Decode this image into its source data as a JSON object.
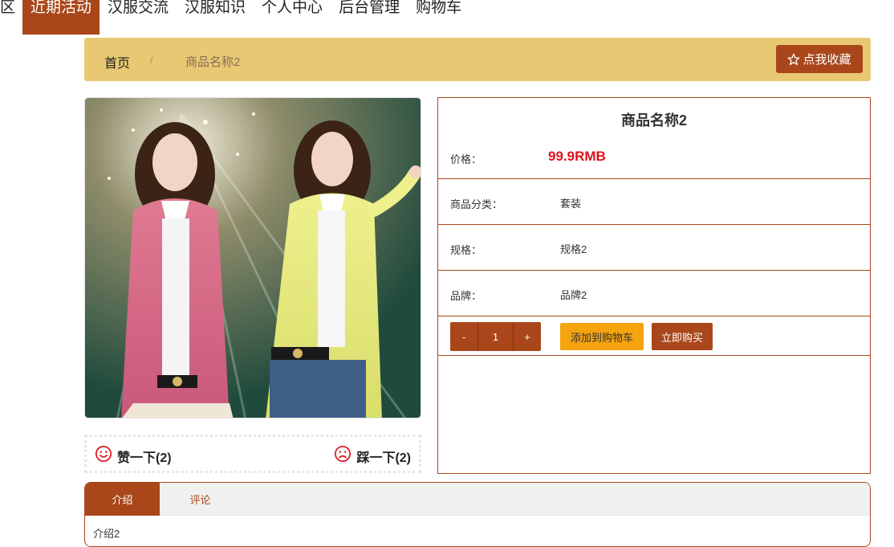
{
  "nav": {
    "items": [
      {
        "label": "区",
        "active": false
      },
      {
        "label": "近期活动",
        "active": true
      },
      {
        "label": "汉服交流",
        "active": false
      },
      {
        "label": "汉服知识",
        "active": false
      },
      {
        "label": "个人中心",
        "active": false
      },
      {
        "label": "后台管理",
        "active": false
      },
      {
        "label": "购物车",
        "active": false
      }
    ]
  },
  "breadcrumb": {
    "home": "首页",
    "separator": "/",
    "current": "商品名称2"
  },
  "favorite_button": {
    "label": "点我收藏",
    "icon": "star-outline-icon"
  },
  "product": {
    "image_alt": "商品图片",
    "title": "商品名称2",
    "price_label": "价格：",
    "price": "99.9RMB",
    "category_label": "商品分类：",
    "category": "套装",
    "spec_label": "规格：",
    "spec": "规格2",
    "brand_label": "品牌：",
    "brand": "品牌2"
  },
  "quantity": {
    "minus": "-",
    "value": "1",
    "plus": "+"
  },
  "actions": {
    "add_to_cart": "添加到购物车",
    "buy_now": "立即购买"
  },
  "votes": {
    "like_label": "赞一下(2)",
    "like_icon": "smile-icon",
    "dislike_label": "踩一下(2)",
    "dislike_icon": "frown-icon"
  },
  "tabs": {
    "items": [
      {
        "label": "介绍",
        "active": true
      },
      {
        "label": "评论",
        "active": false
      }
    ],
    "content": "介绍2"
  },
  "colors": {
    "primary": "#a9471b",
    "breadcrumb_bg": "#e8c872",
    "price": "#e0101a",
    "cart_button": "#f5a30e"
  }
}
